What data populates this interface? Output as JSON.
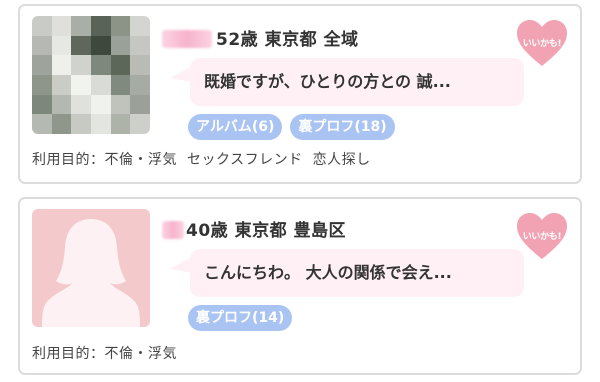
{
  "cards": [
    {
      "profile": "52歳 東京都 全域",
      "message": "既婚ですが、ひとりの方との 誠...",
      "tags": [
        "アルバム(6)",
        "裏プロフ(18)"
      ],
      "purpose_label": "利用目的：",
      "purposes": [
        "不倫・浮気",
        "セックスフレンド",
        "恋人探し"
      ],
      "like_label": "いいかも!"
    },
    {
      "profile": "40歳 東京都 豊島区",
      "message": "こんにちわ。 大人の関係で会え...",
      "tags": [
        "裏プロフ(14)"
      ],
      "purpose_label": "利用目的：",
      "purposes": [
        "不倫・浮気"
      ],
      "like_label": "いいかも!"
    }
  ],
  "colors": {
    "tag": "#a9c3f2",
    "bubble": "#fff0f6",
    "heart": "#f2a3b3",
    "placeholder_avatar": "#f3c9cc",
    "card_border": "#dcdcdc"
  },
  "icons": {
    "like": "heart-icon",
    "avatar_placeholder": "female-silhouette-icon"
  }
}
